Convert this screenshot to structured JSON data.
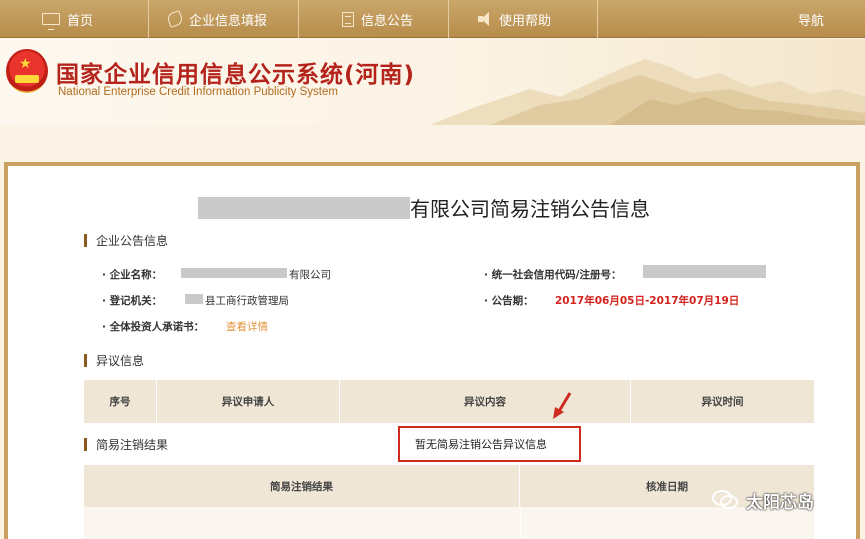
{
  "nav": {
    "items": [
      {
        "label": "首页",
        "icon": "monitor-icon"
      },
      {
        "label": "企业信息填报",
        "icon": "pen-icon"
      },
      {
        "label": "信息公告",
        "icon": "document-icon"
      },
      {
        "label": "使用帮助",
        "icon": "speaker-icon"
      }
    ],
    "guide_label": "导航"
  },
  "header": {
    "title": "国家企业信用信息公示系统(河南)",
    "subtitle": "National Enterprise Credit Information Publicity System"
  },
  "page": {
    "title_suffix": "有限公司简易注销公告信息"
  },
  "sections": {
    "announcement": {
      "heading": "企业公告信息",
      "fields": {
        "name_label": "· 企业名称：",
        "name_suffix": "有限公司",
        "credit_code_label": "· 统一社会信用代码/注册号：",
        "authority_label": "· 登记机关：",
        "authority_suffix": "县工商行政管理局",
        "period_label": "· 公告期：",
        "period_value": "2017年06月05日-2017年07月19日",
        "commitment_label": "· 全体投资人承诺书：",
        "commitment_link": "查看详情"
      }
    },
    "objection": {
      "heading": "异议信息",
      "columns": [
        "序号",
        "异议申请人",
        "异议内容",
        "异议时间"
      ],
      "empty_message": "暂无简易注销公告异议信息"
    },
    "result": {
      "heading": "简易注销结果",
      "columns": [
        "简易注销结果",
        "核准日期"
      ]
    }
  },
  "watermark": "太阳芯岛",
  "colors": {
    "nav_bg": "#b88d4b",
    "title_red": "#b4241c",
    "highlight_red": "#d2231e",
    "link_orange": "#e3953a",
    "panel_border": "#c9a162"
  }
}
